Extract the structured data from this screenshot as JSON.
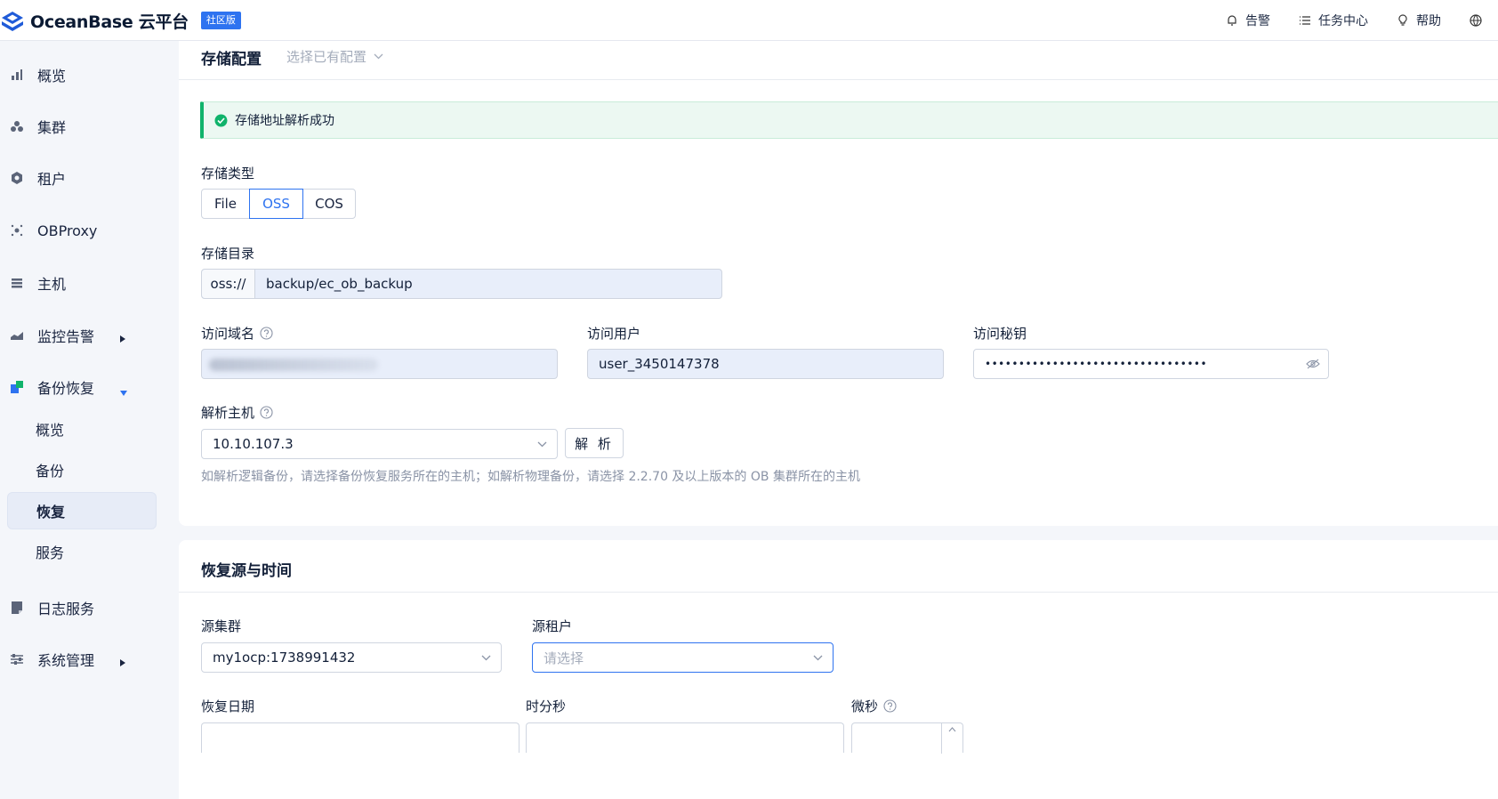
{
  "header": {
    "app_name": "OceanBase 云平台",
    "edition_badge": "社区版",
    "alert_label": "告警",
    "tasks_label": "任务中心",
    "help_label": "帮助"
  },
  "sidebar": {
    "items": [
      {
        "label": "概览",
        "icon": "bar-chart-icon"
      },
      {
        "label": "集群",
        "icon": "cluster-icon"
      },
      {
        "label": "租户",
        "icon": "tenant-icon"
      },
      {
        "label": "OBProxy",
        "icon": "proxy-icon"
      },
      {
        "label": "主机",
        "icon": "host-icon"
      },
      {
        "label": "监控告警",
        "icon": "monitor-icon"
      },
      {
        "label": "备份恢复",
        "icon": "backup-icon"
      },
      {
        "label": "日志服务",
        "icon": "log-icon"
      },
      {
        "label": "系统管理",
        "icon": "settings-icon"
      }
    ],
    "backup_children": [
      "概览",
      "备份",
      "恢复",
      "服务"
    ],
    "active_child": "恢复"
  },
  "storage": {
    "title": "存储配置",
    "preset_select": "选择已有配置",
    "alert_text": "存储地址解析成功",
    "type_label": "存储类型",
    "types": [
      "File",
      "OSS",
      "COS"
    ],
    "selected_type": "OSS",
    "dir_label": "存储目录",
    "dir_prefix": "oss://",
    "dir_value": "backup/ec_ob_backup",
    "domain_label": "访问域名",
    "user_label": "访问用户",
    "user_value": "user_3450147378",
    "secret_label": "访问秘钥",
    "secret_value": "•••••••••••••••••••••••••••••••••",
    "host_label": "解析主机",
    "host_value": "10.10.107.3",
    "parse_button": "解 析",
    "hint": "如解析逻辑备份，请选择备份恢复服务所在的主机；如解析物理备份，请选择 2.2.70 及以上版本的 OB 集群所在的主机"
  },
  "restore": {
    "title": "恢复源与时间",
    "source_cluster_label": "源集群",
    "source_cluster_value": "my1ocp:1738991432",
    "source_tenant_label": "源租户",
    "source_tenant_placeholder": "请选择",
    "date_label": "恢复日期",
    "time_label": "时分秒",
    "micro_label": "微秒"
  },
  "colors": {
    "primary": "#2e73f0",
    "success": "#10b36b",
    "text": "#132039"
  }
}
